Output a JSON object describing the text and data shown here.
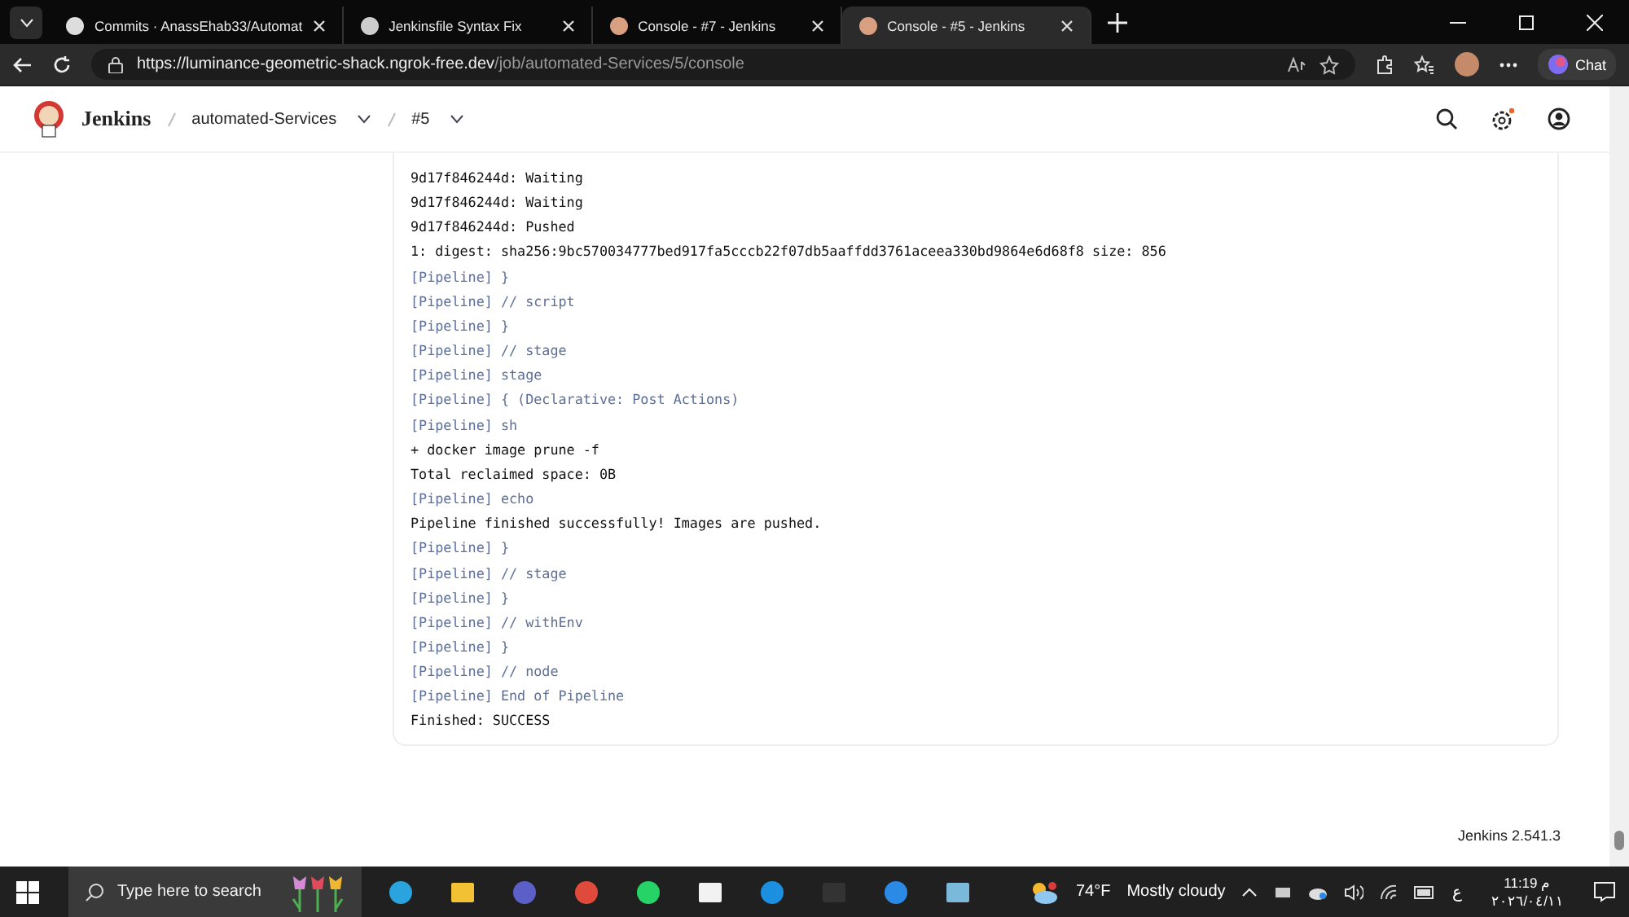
{
  "browser": {
    "tabs": [
      {
        "title": "Commits · AnassEhab33/Automat",
        "selected": false,
        "kind": "github"
      },
      {
        "title": "Jenkinsfile Syntax Fix",
        "selected": false,
        "kind": "chat"
      },
      {
        "title": "Console - #7 - Jenkins",
        "selected": false,
        "kind": "jenkins"
      },
      {
        "title": "Console - #5 - Jenkins",
        "selected": true,
        "kind": "jenkins"
      }
    ],
    "url_host": "https://luminance-geometric-shack.ngrok-free.dev",
    "url_path": "/job/automated-Services/5/console",
    "chat_label": "Chat"
  },
  "header": {
    "brand": "Jenkins",
    "breadcrumbs": [
      "automated-Services",
      "#5"
    ]
  },
  "console": {
    "lines": [
      {
        "kind": "output",
        "text": "9d17f846244d: Waiting"
      },
      {
        "kind": "output",
        "text": "9d17f846244d: Waiting"
      },
      {
        "kind": "output",
        "text": "9d17f846244d: Pushed"
      },
      {
        "kind": "output",
        "text": "1: digest: sha256:9bc570034777bed917fa5cccb22f07db5aaffdd3761aceea330bd9864e6d68f8 size: 856"
      },
      {
        "kind": "pipeline",
        "text": "[Pipeline] }"
      },
      {
        "kind": "pipeline",
        "text": "[Pipeline] // script"
      },
      {
        "kind": "pipeline",
        "text": "[Pipeline] }"
      },
      {
        "kind": "pipeline",
        "text": "[Pipeline] // stage"
      },
      {
        "kind": "pipeline",
        "text": "[Pipeline] stage"
      },
      {
        "kind": "pipeline",
        "text": "[Pipeline] { (Declarative: Post Actions)"
      },
      {
        "kind": "pipeline",
        "text": "[Pipeline] sh"
      },
      {
        "kind": "output",
        "text": "+ docker image prune -f"
      },
      {
        "kind": "output",
        "text": "Total reclaimed space: 0B"
      },
      {
        "kind": "pipeline",
        "text": "[Pipeline] echo"
      },
      {
        "kind": "output",
        "text": "Pipeline finished successfully! Images are pushed."
      },
      {
        "kind": "pipeline",
        "text": "[Pipeline] }"
      },
      {
        "kind": "pipeline",
        "text": "[Pipeline] // stage"
      },
      {
        "kind": "pipeline",
        "text": "[Pipeline] }"
      },
      {
        "kind": "pipeline",
        "text": "[Pipeline] // withEnv"
      },
      {
        "kind": "pipeline",
        "text": "[Pipeline] }"
      },
      {
        "kind": "pipeline",
        "text": "[Pipeline] // node"
      },
      {
        "kind": "pipeline",
        "text": "[Pipeline] End of Pipeline"
      },
      {
        "kind": "output",
        "text": "Finished: SUCCESS"
      }
    ]
  },
  "footer": {
    "version": "Jenkins 2.541.3"
  },
  "taskbar": {
    "search": {
      "placeholder": "Type here to search"
    },
    "apps": [
      {
        "kind": "telegram"
      },
      {
        "kind": "folder"
      },
      {
        "kind": "teams"
      },
      {
        "kind": "chrome"
      },
      {
        "kind": "whatsapp"
      },
      {
        "kind": "notepad"
      },
      {
        "kind": "docker"
      },
      {
        "kind": "terminal"
      },
      {
        "kind": "vscode"
      },
      {
        "kind": "notes"
      }
    ],
    "weather": {
      "temp": "74°F",
      "condition": "Mostly cloudy"
    },
    "language": "ع",
    "time": "11:19 م",
    "date": "٢٠٢٦/٠٤/١١"
  }
}
